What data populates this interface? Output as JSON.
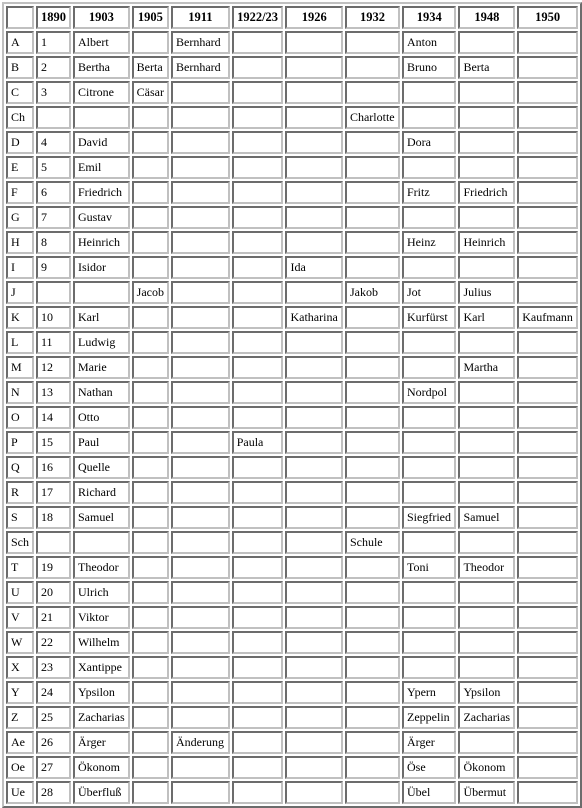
{
  "table": {
    "corner_header": "",
    "columns": [
      {
        "key": "letter",
        "label": ""
      },
      {
        "key": "y1890",
        "label": "1890"
      },
      {
        "key": "y1903",
        "label": "1903"
      },
      {
        "key": "y1905",
        "label": "1905"
      },
      {
        "key": "y1911",
        "label": "1911"
      },
      {
        "key": "y1922",
        "label": "1922/23"
      },
      {
        "key": "y1926",
        "label": "1926"
      },
      {
        "key": "y1932",
        "label": "1932"
      },
      {
        "key": "y1934",
        "label": "1934"
      },
      {
        "key": "y1948",
        "label": "1948"
      },
      {
        "key": "y1950",
        "label": "1950"
      }
    ],
    "rows": [
      {
        "letter": "A",
        "y1890": "1",
        "y1903": "Albert",
        "y1905": "",
        "y1911": "Bernhard",
        "y1922": "",
        "y1926": "",
        "y1932": "",
        "y1934": "Anton",
        "y1948": "",
        "y1950": ""
      },
      {
        "letter": "B",
        "y1890": "2",
        "y1903": "Bertha",
        "y1905": "Berta",
        "y1911": "Bernhard",
        "y1922": "",
        "y1926": "",
        "y1932": "",
        "y1934": "Bruno",
        "y1948": "Berta",
        "y1950": ""
      },
      {
        "letter": "C",
        "y1890": "3",
        "y1903": "Citrone",
        "y1905": "Cäsar",
        "y1911": "",
        "y1922": "",
        "y1926": "",
        "y1932": "",
        "y1934": "",
        "y1948": "",
        "y1950": ""
      },
      {
        "letter": "Ch",
        "y1890": "",
        "y1903": "",
        "y1905": "",
        "y1911": "",
        "y1922": "",
        "y1926": "",
        "y1932": "Charlotte",
        "y1934": "",
        "y1948": "",
        "y1950": ""
      },
      {
        "letter": "D",
        "y1890": "4",
        "y1903": "David",
        "y1905": "",
        "y1911": "",
        "y1922": "",
        "y1926": "",
        "y1932": "",
        "y1934": "Dora",
        "y1948": "",
        "y1950": ""
      },
      {
        "letter": "E",
        "y1890": "5",
        "y1903": "Emil",
        "y1905": "",
        "y1911": "",
        "y1922": "",
        "y1926": "",
        "y1932": "",
        "y1934": "",
        "y1948": "",
        "y1950": ""
      },
      {
        "letter": "F",
        "y1890": "6",
        "y1903": "Friedrich",
        "y1905": "",
        "y1911": "",
        "y1922": "",
        "y1926": "",
        "y1932": "",
        "y1934": "Fritz",
        "y1948": "Friedrich",
        "y1950": ""
      },
      {
        "letter": "G",
        "y1890": "7",
        "y1903": "Gustav",
        "y1905": "",
        "y1911": "",
        "y1922": "",
        "y1926": "",
        "y1932": "",
        "y1934": "",
        "y1948": "",
        "y1950": ""
      },
      {
        "letter": "H",
        "y1890": "8",
        "y1903": "Heinrich",
        "y1905": "",
        "y1911": "",
        "y1922": "",
        "y1926": "",
        "y1932": "",
        "y1934": "Heinz",
        "y1948": "Heinrich",
        "y1950": ""
      },
      {
        "letter": "I",
        "y1890": "9",
        "y1903": "Isidor",
        "y1905": "",
        "y1911": "",
        "y1922": "",
        "y1926": "Ida",
        "y1932": "",
        "y1934": "",
        "y1948": "",
        "y1950": ""
      },
      {
        "letter": "J",
        "y1890": "",
        "y1903": "",
        "y1905": "Jacob",
        "y1911": "",
        "y1922": "",
        "y1926": "",
        "y1932": "Jakob",
        "y1934": "Jot",
        "y1948": "Julius",
        "y1950": ""
      },
      {
        "letter": "K",
        "y1890": "10",
        "y1903": "Karl",
        "y1905": "",
        "y1911": "",
        "y1922": "",
        "y1926": "Katharina",
        "y1932": "",
        "y1934": "Kurfürst",
        "y1948": "Karl",
        "y1950": "Kaufmann"
      },
      {
        "letter": "L",
        "y1890": "11",
        "y1903": "Ludwig",
        "y1905": "",
        "y1911": "",
        "y1922": "",
        "y1926": "",
        "y1932": "",
        "y1934": "",
        "y1948": "",
        "y1950": ""
      },
      {
        "letter": "M",
        "y1890": "12",
        "y1903": "Marie",
        "y1905": "",
        "y1911": "",
        "y1922": "",
        "y1926": "",
        "y1932": "",
        "y1934": "",
        "y1948": "Martha",
        "y1950": ""
      },
      {
        "letter": "N",
        "y1890": "13",
        "y1903": "Nathan",
        "y1905": "",
        "y1911": "",
        "y1922": "",
        "y1926": "",
        "y1932": "",
        "y1934": "Nordpol",
        "y1948": "",
        "y1950": ""
      },
      {
        "letter": "O",
        "y1890": "14",
        "y1903": "Otto",
        "y1905": "",
        "y1911": "",
        "y1922": "",
        "y1926": "",
        "y1932": "",
        "y1934": "",
        "y1948": "",
        "y1950": ""
      },
      {
        "letter": "P",
        "y1890": "15",
        "y1903": "Paul",
        "y1905": "",
        "y1911": "",
        "y1922": "Paula",
        "y1926": "",
        "y1932": "",
        "y1934": "",
        "y1948": "",
        "y1950": ""
      },
      {
        "letter": "Q",
        "y1890": "16",
        "y1903": "Quelle",
        "y1905": "",
        "y1911": "",
        "y1922": "",
        "y1926": "",
        "y1932": "",
        "y1934": "",
        "y1948": "",
        "y1950": ""
      },
      {
        "letter": "R",
        "y1890": "17",
        "y1903": "Richard",
        "y1905": "",
        "y1911": "",
        "y1922": "",
        "y1926": "",
        "y1932": "",
        "y1934": "",
        "y1948": "",
        "y1950": ""
      },
      {
        "letter": "S",
        "y1890": "18",
        "y1903": "Samuel",
        "y1905": "",
        "y1911": "",
        "y1922": "",
        "y1926": "",
        "y1932": "",
        "y1934": "Siegfried",
        "y1948": "Samuel",
        "y1950": ""
      },
      {
        "letter": "Sch",
        "y1890": "",
        "y1903": "",
        "y1905": "",
        "y1911": "",
        "y1922": "",
        "y1926": "",
        "y1932": "Schule",
        "y1934": "",
        "y1948": "",
        "y1950": ""
      },
      {
        "letter": "T",
        "y1890": "19",
        "y1903": "Theodor",
        "y1905": "",
        "y1911": "",
        "y1922": "",
        "y1926": "",
        "y1932": "",
        "y1934": "Toni",
        "y1948": "Theodor",
        "y1950": ""
      },
      {
        "letter": "U",
        "y1890": "20",
        "y1903": "Ulrich",
        "y1905": "",
        "y1911": "",
        "y1922": "",
        "y1926": "",
        "y1932": "",
        "y1934": "",
        "y1948": "",
        "y1950": ""
      },
      {
        "letter": "V",
        "y1890": "21",
        "y1903": "Viktor",
        "y1905": "",
        "y1911": "",
        "y1922": "",
        "y1926": "",
        "y1932": "",
        "y1934": "",
        "y1948": "",
        "y1950": ""
      },
      {
        "letter": "W",
        "y1890": "22",
        "y1903": "Wilhelm",
        "y1905": "",
        "y1911": "",
        "y1922": "",
        "y1926": "",
        "y1932": "",
        "y1934": "",
        "y1948": "",
        "y1950": ""
      },
      {
        "letter": "X",
        "y1890": "23",
        "y1903": "Xantippe",
        "y1905": "",
        "y1911": "",
        "y1922": "",
        "y1926": "",
        "y1932": "",
        "y1934": "",
        "y1948": "",
        "y1950": ""
      },
      {
        "letter": "Y",
        "y1890": "24",
        "y1903": "Ypsilon",
        "y1905": "",
        "y1911": "",
        "y1922": "",
        "y1926": "",
        "y1932": "",
        "y1934": "Ypern",
        "y1948": "Ypsilon",
        "y1950": ""
      },
      {
        "letter": "Z",
        "y1890": "25",
        "y1903": "Zacharias",
        "y1905": "",
        "y1911": "",
        "y1922": "",
        "y1926": "",
        "y1932": "",
        "y1934": "Zeppelin",
        "y1948": "Zacharias",
        "y1950": ""
      },
      {
        "letter": "Ae",
        "y1890": "26",
        "y1903": "Ärger",
        "y1905": "",
        "y1911": "Änderung",
        "y1922": "",
        "y1926": "",
        "y1932": "",
        "y1934": "Ärger",
        "y1948": "",
        "y1950": ""
      },
      {
        "letter": "Oe",
        "y1890": "27",
        "y1903": "Ökonom",
        "y1905": "",
        "y1911": "",
        "y1922": "",
        "y1926": "",
        "y1932": "",
        "y1934": "Öse",
        "y1948": "Ökonom",
        "y1950": ""
      },
      {
        "letter": "Ue",
        "y1890": "28",
        "y1903": "Überfluß",
        "y1905": "",
        "y1911": "",
        "y1922": "",
        "y1926": "",
        "y1932": "",
        "y1934": "Übel",
        "y1948": "Übermut",
        "y1950": ""
      }
    ]
  }
}
